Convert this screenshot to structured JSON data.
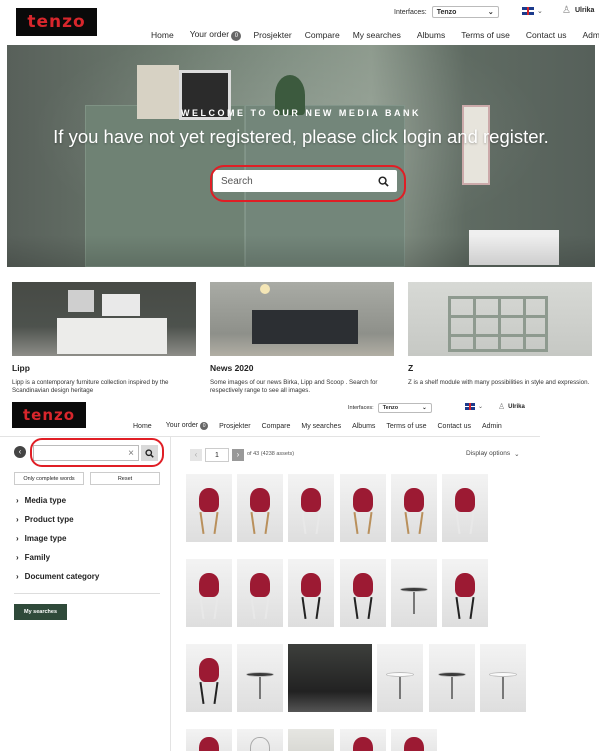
{
  "top": {
    "logo": "tenzo",
    "interfaces_label": "Interfaces:",
    "interface_value": "Tenzo",
    "user_name": "Ulrika",
    "nav": [
      "Home",
      "Your order",
      "Prosjekter",
      "Compare",
      "My searches",
      "Albums",
      "Terms of use",
      "Contact us",
      "Admin"
    ],
    "order_count": "0"
  },
  "hero": {
    "kicker": "WELCOME TO OUR NEW MEDIA BANK",
    "headline": "If you have not yet registered, please click login and register.",
    "search_placeholder": "Search"
  },
  "cards": [
    {
      "title": "Lipp",
      "text": "Lipp is a contemporary furniture collection inspired by the Scandinavian design heritage"
    },
    {
      "title": "News 2020",
      "text": "Some images of our news Birka, Lipp and Scoop . Search for respectively range to see all images."
    },
    {
      "title": "Z",
      "text": "Z is a shelf module with many possibilities in style and expression."
    }
  ],
  "second": {
    "logo": "tenzo",
    "interfaces_label": "Interfaces:",
    "interface_value": "Tenzo",
    "user_name": "Ulrika",
    "nav": [
      "Home",
      "Your order",
      "Prosjekter",
      "Compare",
      "My searches",
      "Albums",
      "Terms of use",
      "Contact us",
      "Admin"
    ],
    "order_count": "0"
  },
  "sidebar": {
    "clear_symbol": "×",
    "only_complete": "Only complete words",
    "reset": "Reset",
    "filters": [
      "Media type",
      "Product type",
      "Image type",
      "Family",
      "Document category"
    ],
    "my_searches": "My searches"
  },
  "results": {
    "page": "1",
    "page_info": "of 43 (4238 assets)",
    "display_options": "Display options"
  },
  "colors": {
    "brand_red": "#d8262c",
    "annotation": "#e01e25",
    "dark_green": "#2f4a3a",
    "chair_red": "#9c1a33"
  }
}
